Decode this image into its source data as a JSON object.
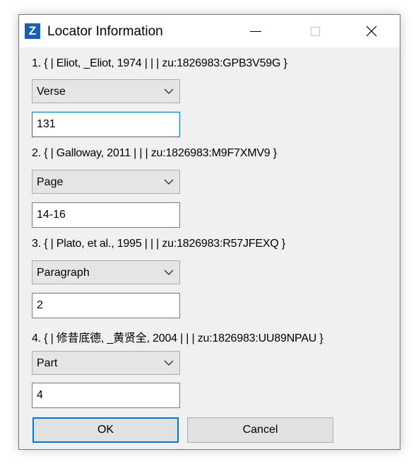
{
  "window": {
    "title": "Locator Information",
    "app_icon_letter": "Z"
  },
  "entries": [
    {
      "reference": "1. { | Eliot, _Eliot, 1974 | | | zu:1826983:GPB3V59G }",
      "locator_type": "Verse",
      "locator_value": "131"
    },
    {
      "reference": "2. { | Galloway, 2011 | | | zu:1826983:M9F7XMV9 }",
      "locator_type": "Page",
      "locator_value": "14-16"
    },
    {
      "reference": "3. { | Plato, et al., 1995 | | | zu:1826983:R57JFEXQ }",
      "locator_type": "Paragraph",
      "locator_value": "2"
    },
    {
      "reference": "4. { | 修昔底德, _黄贤全, 2004 | | | zu:1826983:UU89NPAU }",
      "locator_type": "Part",
      "locator_value": "4"
    }
  ],
  "buttons": {
    "ok_label": "OK",
    "cancel_label": "Cancel"
  },
  "colors": {
    "accent": "#0078d7",
    "app_icon": "#1a5fb4"
  },
  "icons": {
    "minimize": "minimize-icon",
    "maximize": "maximize-icon",
    "close": "close-icon",
    "dropdown": "chevron-down-icon"
  }
}
